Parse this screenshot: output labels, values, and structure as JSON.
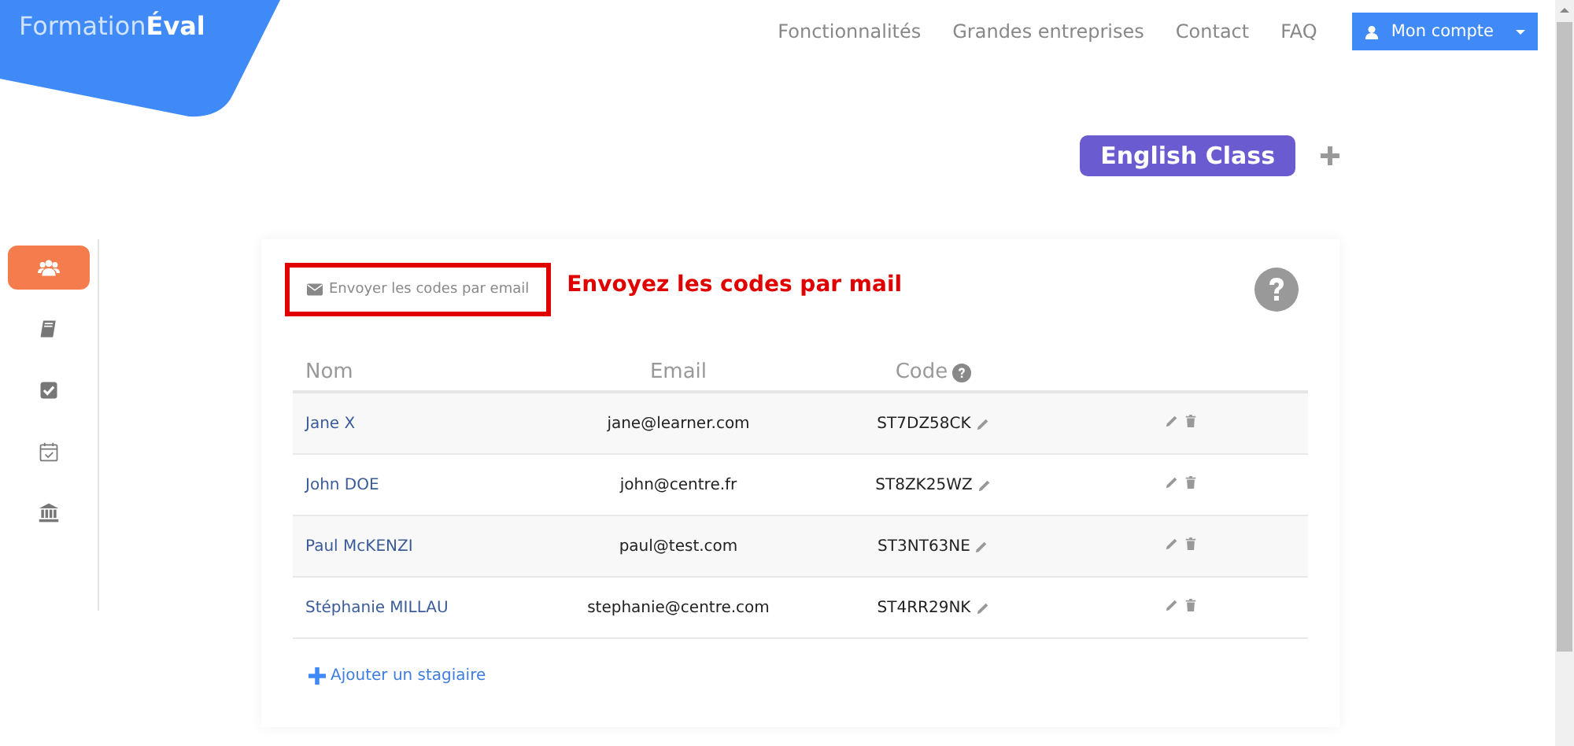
{
  "header": {
    "logo": "Formation**Éval**",
    "nav": [
      "Fonctionnalités",
      "Grandes entreprises",
      "Contact",
      "FAQ"
    ],
    "account_button": "Mon compte"
  },
  "class_tab": {
    "label": "English Class"
  },
  "sidebar": {
    "items": [
      {
        "kind": "group",
        "selected": true
      },
      {
        "kind": "book",
        "selected": false
      },
      {
        "kind": "check",
        "selected": false
      },
      {
        "kind": "calendar",
        "selected": false
      },
      {
        "kind": "bank",
        "selected": false
      }
    ]
  },
  "card": {
    "send_codes_button": "Envoyer les codes par email",
    "annotation": "Envoyez les codes par mail",
    "table": {
      "columns": [
        "Nom",
        "Email",
        "Code"
      ],
      "rows": [
        {
          "name": "Jane X",
          "email": "jane@learner.com",
          "code": "ST7DZ58CK"
        },
        {
          "name": "John DOE",
          "email": "john@centre.fr",
          "code": "ST8ZK25WZ"
        },
        {
          "name": "Paul McKENZI",
          "email": "paul@test.com",
          "code": "ST3NT63NE"
        },
        {
          "name": "Stéphanie MILLAU",
          "email": "stephanie@centre.com",
          "code": "ST4RR29NK"
        }
      ]
    },
    "add_button": "Ajouter un stagiaire"
  }
}
